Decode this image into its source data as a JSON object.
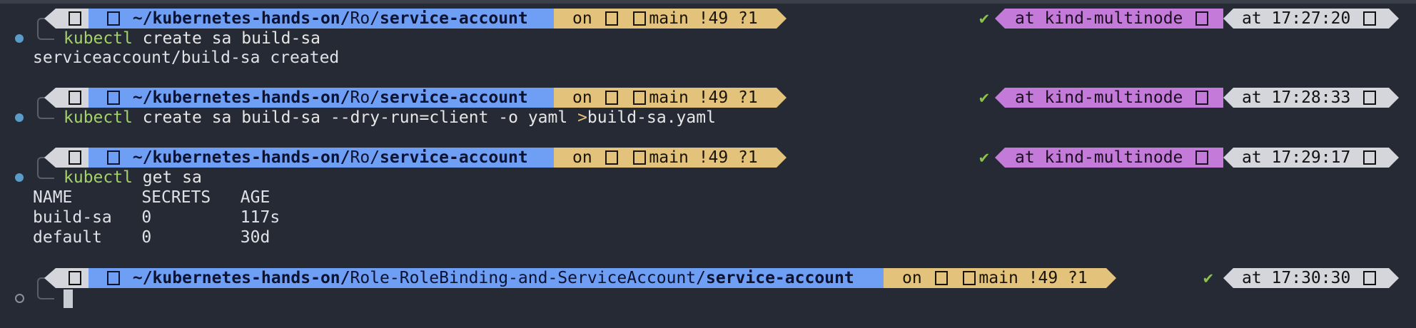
{
  "terminal": {
    "prompts": [
      {
        "os_icon": "apple-icon",
        "home_icon": "home-folder-icon",
        "path_prefix": "~/kubernetes-hands-on/",
        "path_mid": "Ro/",
        "path_last": "service-account",
        "git_on": "on",
        "git_icon": "github-icon",
        "branch_icon": "branch-icon",
        "branch": "main !49 ?1",
        "status": "✔",
        "context": "at kind-multinode",
        "ctx_icon": "kubernetes-icon",
        "time": "at 17:27:20",
        "clock_icon": "clock-icon",
        "command_kw": "kubectl",
        "command_rest": " create sa build-sa",
        "command_redir": "",
        "command_tail": "",
        "output": [
          "serviceaccount/build-sa created"
        ]
      },
      {
        "path_prefix": "~/kubernetes-hands-on/",
        "path_mid": "Ro/",
        "path_last": "service-account",
        "git_on": "on",
        "branch": "main !49 ?1",
        "status": "✔",
        "context": "at kind-multinode",
        "time": "at 17:28:33",
        "command_kw": "kubectl",
        "command_rest": " create sa build-sa --dry-run=client -o yaml ",
        "command_redir": ">",
        "command_tail": "build-sa.yaml",
        "output": []
      },
      {
        "path_prefix": "~/kubernetes-hands-on/",
        "path_mid": "Ro/",
        "path_last": "service-account",
        "git_on": "on",
        "branch": "main !49 ?1",
        "status": "✔",
        "context": "at kind-multinode",
        "time": "at 17:29:17",
        "command_kw": "kubectl",
        "command_rest": " get sa",
        "command_redir": "",
        "command_tail": "",
        "output": [
          "NAME       SECRETS   AGE",
          "build-sa   0         117s",
          "default    0         30d"
        ]
      },
      {
        "path_prefix": "~/kubernetes-hands-on/",
        "path_mid": "Role-RoleBinding-and-ServiceAccount/",
        "path_last": "service-account",
        "git_on": "on",
        "branch": "main !49 ?1",
        "status": "✔",
        "time": "at 17:30:30"
      }
    ],
    "colors": {
      "background": "#262a34",
      "path_segment": "#6f9ef5",
      "git_segment": "#e3c27b",
      "context_segment": "#c37ad9",
      "time_segment": "#d4d6dc",
      "command_keyword": "#a3d16a"
    }
  }
}
